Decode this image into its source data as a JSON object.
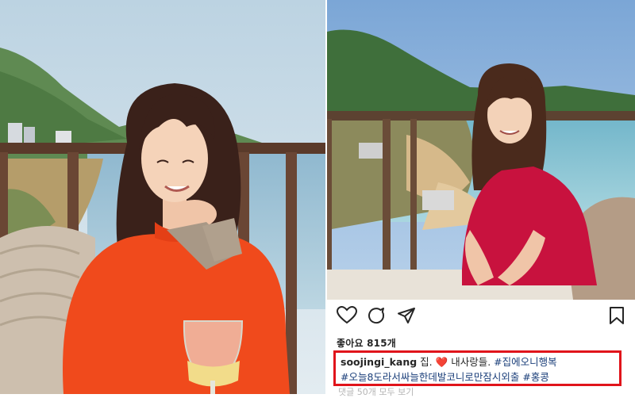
{
  "post": {
    "likes_label": "좋아요",
    "likes_count": "815개",
    "username": "soojingi_kang",
    "caption_part1": "집.",
    "caption_heart": "❤️",
    "caption_part2": "내사랑들.",
    "tag1": "#집에오니행복",
    "tag2": "#오늘8도라서싸늘한데발코니로만잠시외출",
    "tag3": "#홍콩",
    "comments_label": "댓글 50개 모두 보기"
  },
  "icons": {
    "like": "heart-icon",
    "comment": "comment-icon",
    "share": "paper-plane-icon",
    "save": "bookmark-icon"
  },
  "colors": {
    "highlight_border": "#e0141b",
    "hashtag": "#1b3f7a",
    "sweater_orange": "#f04a1c",
    "top_red": "#c8123e"
  }
}
